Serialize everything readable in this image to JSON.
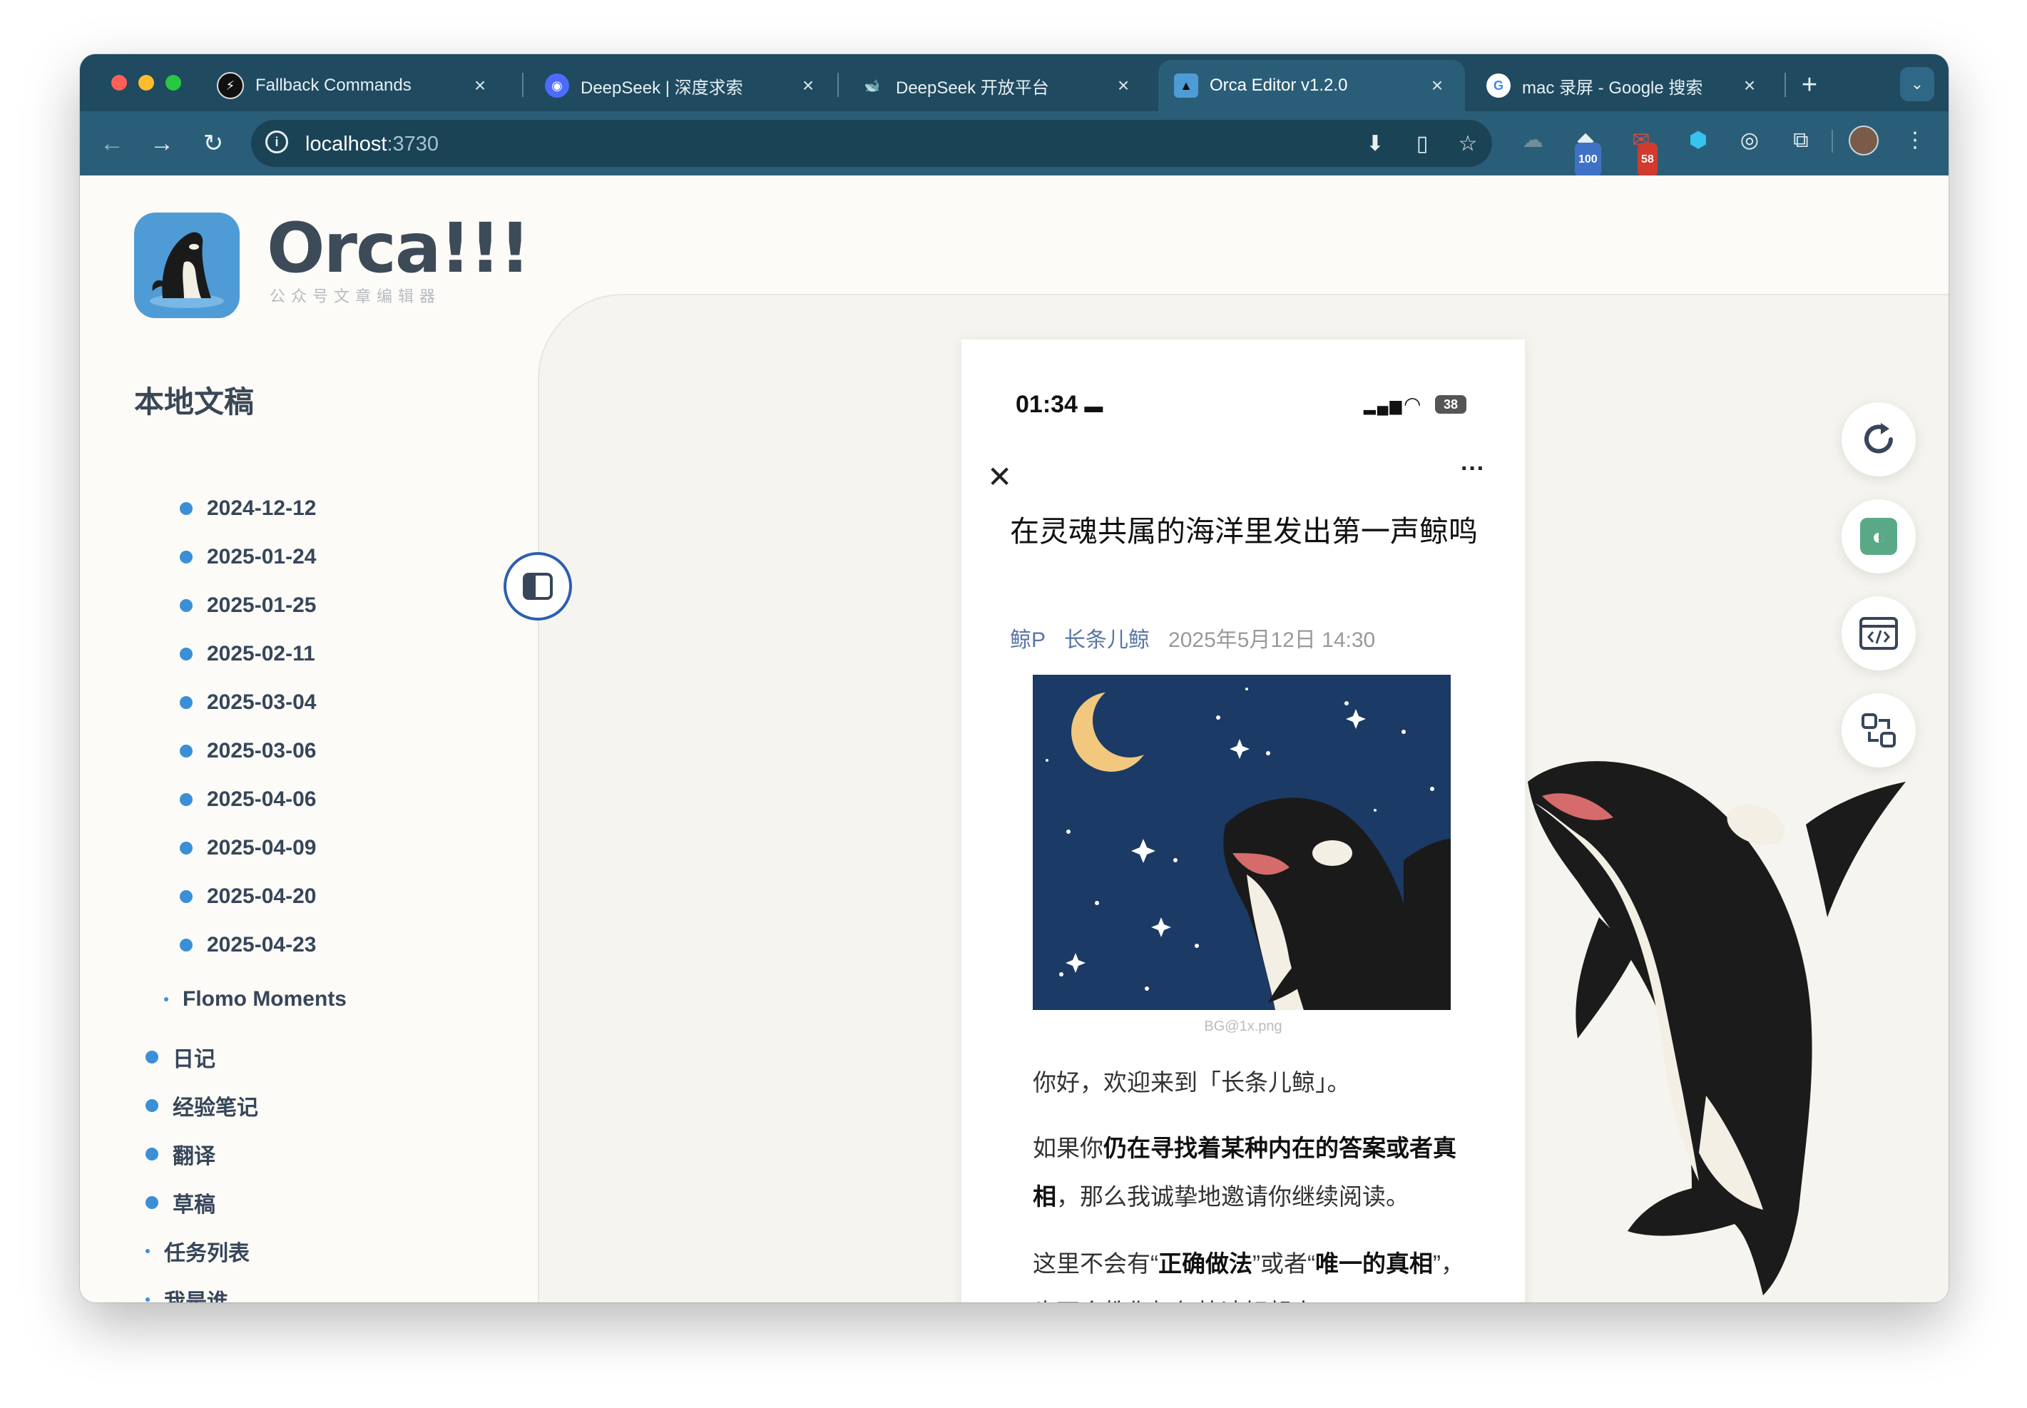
{
  "browser": {
    "tabs": [
      {
        "title": "Fallback Commands",
        "active": false
      },
      {
        "title": "DeepSeek | 深度求索",
        "active": false
      },
      {
        "title": "DeepSeek 开放平台",
        "active": false
      },
      {
        "title": "Orca Editor v1.2.0",
        "active": true
      },
      {
        "title": "mac 录屏 - Google 搜索",
        "active": false
      }
    ],
    "close_glyph": "×",
    "new_tab_glyph": "+",
    "url_host": "localhost",
    "url_port": ":3730",
    "badges": {
      "ext1": "100",
      "ext2": "58"
    }
  },
  "app": {
    "logo_text": "Orca!!!",
    "logo_subtitle": "公众号文章编辑器",
    "sidebar_title": "本地文稿",
    "sidebar_items": [
      {
        "label": "2024-12-12",
        "level": 2,
        "marker": "dot"
      },
      {
        "label": "2025-01-24",
        "level": 2,
        "marker": "dot"
      },
      {
        "label": "2025-01-25",
        "level": 2,
        "marker": "dot"
      },
      {
        "label": "2025-02-11",
        "level": 2,
        "marker": "dot"
      },
      {
        "label": "2025-03-04",
        "level": 2,
        "marker": "dot"
      },
      {
        "label": "2025-03-06",
        "level": 2,
        "marker": "dot"
      },
      {
        "label": "2025-04-06",
        "level": 2,
        "marker": "dot"
      },
      {
        "label": "2025-04-09",
        "level": 2,
        "marker": "dot"
      },
      {
        "label": "2025-04-20",
        "level": 2,
        "marker": "dot"
      },
      {
        "label": "2025-04-23",
        "level": 2,
        "marker": "dot"
      },
      {
        "label": "Flomo Moments",
        "level": 1,
        "marker": "small"
      },
      {
        "label": "日记",
        "level": 0,
        "marker": "dot"
      },
      {
        "label": "经验笔记",
        "level": 0,
        "marker": "dot"
      },
      {
        "label": "翻译",
        "level": 0,
        "marker": "dot"
      },
      {
        "label": "草稿",
        "level": 0,
        "marker": "dot"
      },
      {
        "label": "任务列表",
        "level": 0,
        "marker": "small"
      },
      {
        "label": "我是谁",
        "level": 0,
        "marker": "small"
      }
    ]
  },
  "preview": {
    "status_time": "01:34",
    "battery": "38",
    "more_glyph": "···",
    "title": "在灵魂共属的海洋里发出第一声鲸鸣",
    "author_1": "鲸P",
    "author_2": "长条儿鲸",
    "date": "2025年5月12日 14:30",
    "image_caption": "BG@1x.png",
    "para1": "你好，欢迎来到「长条儿鲸」。",
    "para2_a": "如果你",
    "para2_b": "仍在寻找着某种内在的答案或者真相",
    "para2_c": "，那么我诚挚地邀请你继续阅读。",
    "para3_a": "这里不会有“",
    "para3_b": "正确做法",
    "para3_c": "”或者“",
    "para3_d": "唯一的真相",
    "para3_e": "”，也不会教你如何快速好起来。"
  },
  "colors": {
    "tabstrip": "#1f4a60",
    "toolbar": "#2a5e78",
    "accent": "#3b8fd6",
    "logo_bg": "#4f9bd5",
    "wechat_green": "#5aa986"
  },
  "icons": [
    "back-icon",
    "forward-icon",
    "reload-icon",
    "info-icon",
    "install-icon",
    "reader-icon",
    "star-icon",
    "refresh-icon",
    "wechat-icon",
    "code-icon",
    "swap-icon",
    "close-icon",
    "more-icon",
    "sidebar-toggle-icon"
  ]
}
